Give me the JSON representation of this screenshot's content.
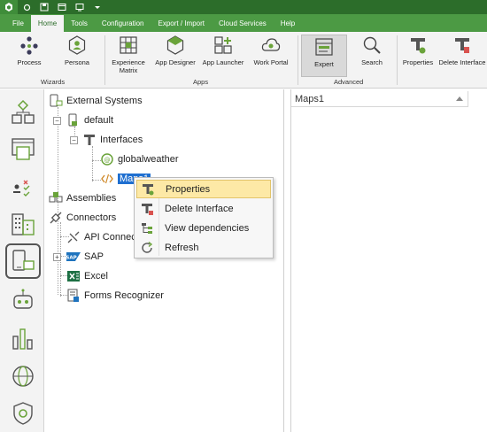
{
  "titlebar": {
    "quick_access": [
      "app-logo-icon",
      "add-icon",
      "save-icon",
      "window-icon",
      "screen-icon",
      "dropdown-icon"
    ]
  },
  "menu": {
    "tabs": [
      "File",
      "Home",
      "Tools",
      "Configuration",
      "Export / Import",
      "Cloud Services",
      "Help"
    ],
    "active": "Home"
  },
  "ribbon": {
    "buttons": {
      "process": "Process",
      "persona": "Persona",
      "experience_matrix_1": "Experience",
      "experience_matrix_2": "Matrix",
      "app_designer": "App Designer",
      "app_launcher": "App Launcher",
      "work_portal": "Work Portal",
      "expert": "Expert",
      "search": "Search",
      "properties": "Properties",
      "delete_interface": "Delete Interface"
    },
    "groups": {
      "wizards": "Wizards",
      "apps": "Apps",
      "advanced": "Advanced"
    }
  },
  "rail": {
    "items": [
      "process-modeling-icon",
      "user-interface-icon",
      "business-rules-icon",
      "organization-icon",
      "integration-icon",
      "bot-icon",
      "analytics-icon",
      "portal-icon",
      "security-icon"
    ],
    "active": "integration-icon"
  },
  "tree": {
    "external_systems": "External Systems",
    "default": "default",
    "interfaces": "Interfaces",
    "globalweather": "globalweather",
    "maps": "Maps1",
    "assemblies": "Assemblies",
    "connectors": "Connectors",
    "api_connectors": "API Connectors",
    "sap": "SAP",
    "excel": "Excel",
    "forms_recognizer": "Forms Recognizer"
  },
  "right_panel": {
    "header": "Maps1"
  },
  "context_menu": {
    "items": [
      "Properties",
      "Delete Interface",
      "View dependencies",
      "Refresh"
    ],
    "highlighted": "Properties"
  },
  "colors": {
    "title_green": "#2c6d2a",
    "menu_green": "#4c9a44",
    "icon_green": "#6aa33a",
    "selection_blue": "#1f6fd0",
    "menu_highlight": "#fde9a6"
  }
}
